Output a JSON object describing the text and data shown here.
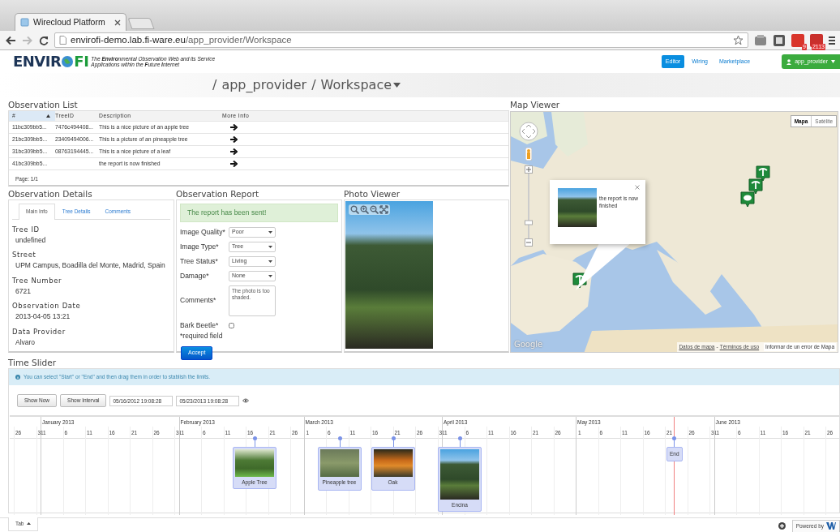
{
  "browser": {
    "tab_title": "Wirecloud Platform",
    "url_host": "envirofi-demo.lab.fi-ware.eu",
    "url_path": "/app_provider/Workspace",
    "badges": [
      "9",
      "2113"
    ]
  },
  "header": {
    "logo_start": "ENVIR",
    "logo_end": "FI",
    "tagline": "The **Enviro**nmental Observation Web and its Service Applications within the **F**uture **I**nternet",
    "nav": [
      {
        "label": "Editor",
        "selected": true
      },
      {
        "label": "Wiring",
        "selected": false
      },
      {
        "label": "Marketplace",
        "selected": false
      }
    ],
    "user": "app_provider"
  },
  "breadcrumb": {
    "separator": "/",
    "items": [
      "app_provider",
      "Workspace"
    ]
  },
  "observation_list": {
    "title": "Observation List",
    "columns": [
      {
        "label": "#",
        "sorted": true
      },
      {
        "label": "TreeID",
        "sorted": false
      },
      {
        "label": "Description",
        "sorted": false
      },
      {
        "label": "More Info",
        "sorted": false
      }
    ],
    "rows": [
      {
        "id": "11bc309bb5...",
        "tree_id": "7476c494408...",
        "description": "This is a nice picture of an apple tree"
      },
      {
        "id": "21bc309bb5...",
        "tree_id": "23409494006...",
        "description": "This is a picture of an pineapple tree"
      },
      {
        "id": "31bc309bb5...",
        "tree_id": "08763194445...",
        "description": "This is a nice picture of a leaf"
      },
      {
        "id": "41bc309bb5...",
        "description": "the report is now finished"
      }
    ],
    "footer": "Page: 1/1"
  },
  "observation_details": {
    "title": "Observation Details",
    "tabs": [
      {
        "label": "Main Info",
        "selected": true
      },
      {
        "label": "Tree Details",
        "selected": false
      },
      {
        "label": "Comments",
        "selected": false
      }
    ],
    "fields": [
      {
        "label": "Tree ID",
        "value": "undefined"
      },
      {
        "label": "Street",
        "value": "UPM Campus, Boadilla del Monte, Madrid, Spain"
      },
      {
        "label": "Tree Number",
        "value": "6721"
      },
      {
        "label": "Observation Date",
        "value": "2013-04-05 13:21"
      },
      {
        "label": "Data Provider",
        "value": "Alvaro"
      }
    ]
  },
  "observation_report": {
    "title": "Observation Report",
    "alert": "The report has been sent!",
    "fields": [
      {
        "kind": "select",
        "label": "Image Quality*",
        "value": "Poor"
      },
      {
        "kind": "select",
        "label": "Image Type*",
        "value": "Tree"
      },
      {
        "kind": "select",
        "label": "Tree Status*",
        "value": "Living"
      },
      {
        "kind": "select",
        "label": "Damage*",
        "value": "None"
      },
      {
        "kind": "textarea",
        "label": "Comments*",
        "value": "The photo is too shaded."
      },
      {
        "kind": "checkbox",
        "label": "Bark Beetle*",
        "checked": false
      }
    ],
    "note": "*required field",
    "button": "Accept"
  },
  "photo_viewer": {
    "title": "Photo Viewer"
  },
  "map_viewer": {
    "title": "Map Viewer",
    "map_types": [
      {
        "label": "Mapa",
        "selected": true
      },
      {
        "label": "Satélite",
        "selected": false
      }
    ],
    "zoom": {
      "level": 0.25
    },
    "popup_text": "the report is now finished",
    "logo": "Google",
    "footer_links": [
      "Datos de mapa",
      "Términos de uso"
    ],
    "footer_separator": "-",
    "report_link": "Informar de un error de Mapa"
  },
  "time_slider": {
    "title": "Time Slider",
    "info": "You can select \"Start\" or \"End\" and then drag them in order to stablish the limits.",
    "buttons": [
      "Show Now",
      "Show Interval"
    ],
    "start": "05/16/2012 19:08:28",
    "end": "05/23/2013 19:08:28",
    "lead_ticks": [
      "26",
      "31"
    ],
    "months": [
      {
        "label": "January 2013",
        "ticks": [
          "1",
          "6",
          "11",
          "16",
          "21",
          "26",
          "31"
        ]
      },
      {
        "label": "February 2013",
        "ticks": [
          "1",
          "6",
          "11",
          "16",
          "21",
          "26"
        ]
      },
      {
        "label": "March 2013",
        "ticks": [
          "1",
          "6",
          "11",
          "16",
          "21",
          "26",
          "31"
        ]
      },
      {
        "label": "April 2013",
        "ticks": [
          "1",
          "6",
          "11",
          "16",
          "21",
          "26"
        ]
      },
      {
        "label": "May 2013",
        "ticks": [
          "1",
          "6",
          "11",
          "16",
          "21",
          "26",
          "31"
        ]
      },
      {
        "label": "June 2013",
        "ticks": [
          "1",
          "6",
          "11",
          "16",
          "21",
          "26"
        ]
      }
    ],
    "events": [
      {
        "kind": "photo",
        "label": "Apple Tree"
      },
      {
        "kind": "photo",
        "label": "Pineapple tree"
      },
      {
        "kind": "photo",
        "label": "Oak"
      },
      {
        "kind": "portrait",
        "label": "Encina"
      },
      {
        "kind": "limit",
        "label": "End"
      }
    ]
  },
  "footer": {
    "tab": "Tab",
    "powered_by": "Powered by"
  }
}
